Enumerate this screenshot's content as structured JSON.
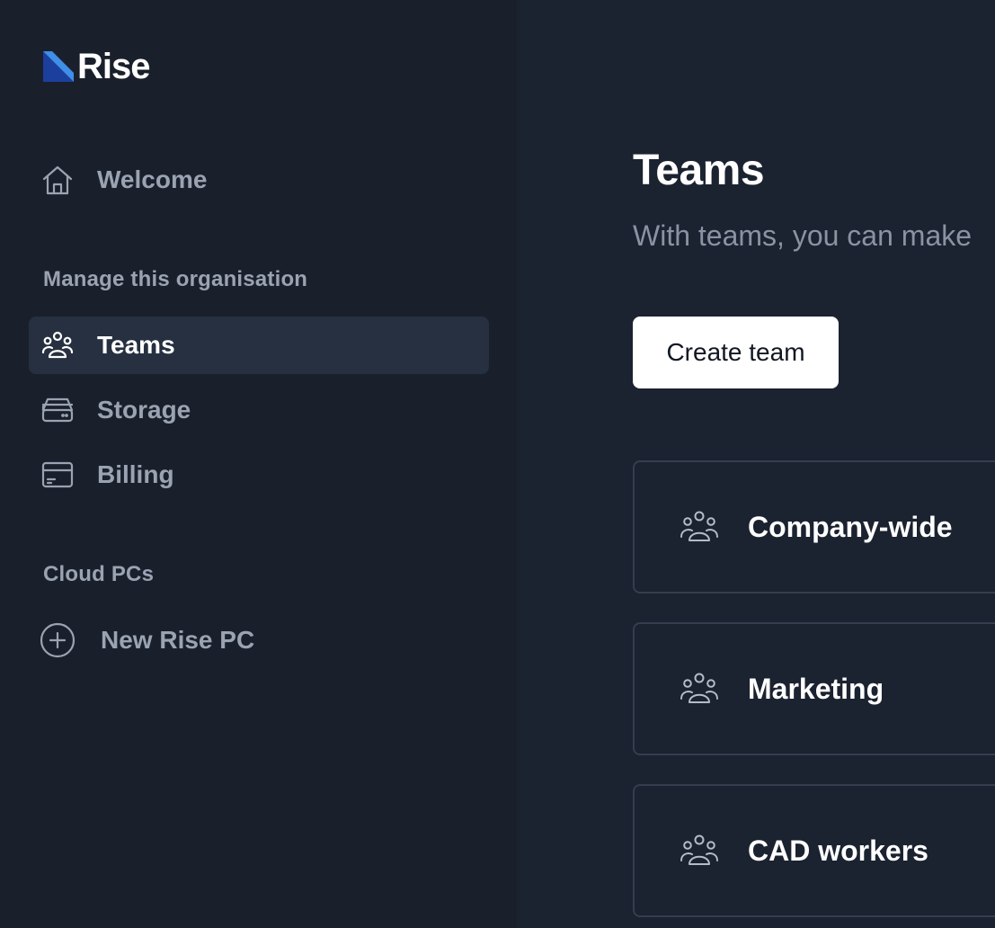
{
  "brand": {
    "name": "Rise",
    "accent_dark": "#1c3f9e",
    "accent_light": "#3f8ee8"
  },
  "sidebar": {
    "welcome_label": "Welcome",
    "manage_section_label": "Manage this organisation",
    "items": [
      {
        "label": "Teams",
        "icon": "people-icon",
        "active": true
      },
      {
        "label": "Storage",
        "icon": "server-icon",
        "active": false
      },
      {
        "label": "Billing",
        "icon": "credit-card-icon",
        "active": false
      }
    ],
    "cloud_section_label": "Cloud PCs",
    "new_pc_label": "New Rise PC"
  },
  "main": {
    "title": "Teams",
    "subtitle": "With teams, you can make",
    "create_button_label": "Create team",
    "teams": [
      {
        "name": "Company-wide",
        "icon": "people-icon"
      },
      {
        "name": "Marketing",
        "icon": "people-icon"
      },
      {
        "name": "CAD workers",
        "icon": "people-icon"
      }
    ]
  }
}
